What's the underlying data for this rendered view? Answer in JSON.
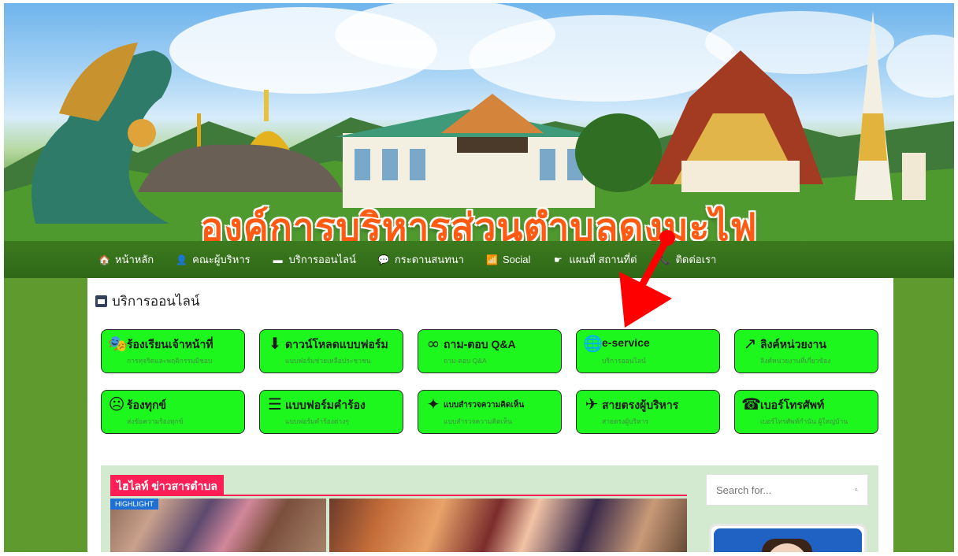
{
  "banner": {
    "title": "องค์การบริหารส่วนตำบลดงมะไฟ"
  },
  "nav": {
    "items": [
      {
        "label": "หน้าหลัก",
        "icon": "home-icon",
        "glyph": "🏠"
      },
      {
        "label": "คณะผู้บริหาร",
        "icon": "user-icon",
        "glyph": "👤"
      },
      {
        "label": "บริการออนไลน์",
        "icon": "window-icon",
        "glyph": "▬"
      },
      {
        "label": "กระดานสนทนา",
        "icon": "comments-icon",
        "glyph": "💬"
      },
      {
        "label": "Social",
        "icon": "rss-icon",
        "glyph": "📶"
      },
      {
        "label": "แผนที่ สถานที่ต่",
        "icon": "map-icon",
        "glyph": "☛"
      },
      {
        "label": "ติดต่อเรา",
        "icon": "phone-icon",
        "glyph": "📞"
      }
    ]
  },
  "services": {
    "heading": "บริการออนไลน์",
    "tiles": [
      {
        "title": "ร้องเรียนเจ้าหน้าที่",
        "sub": "การทุจริตและพฤติกรรมมิชอบ",
        "icon": "masks-icon",
        "glyph": "🎭"
      },
      {
        "title": "ดาวน์โหลดแบบฟอร์ม",
        "sub": "แบบฟอร์มช่วยเหลือประชาชน",
        "icon": "download-circle-icon",
        "glyph": "⬇"
      },
      {
        "title": "ถาม-ตอบ Q&A",
        "sub": "ถาม-ตอบ Q&A",
        "icon": "infinity-icon",
        "glyph": "∞"
      },
      {
        "title": "e-service",
        "sub": "บริการออนไลน์",
        "icon": "globe-icon",
        "glyph": "🌐"
      },
      {
        "title": "ลิงค์หน่วยงาน",
        "sub": "ลิงค์หน่วยงานที่เกี่ยวข้อง",
        "icon": "external-link-icon",
        "glyph": "↗"
      },
      {
        "title": "ร้องทุกข์",
        "sub": "ส่งข้อความร้องทุกข์",
        "icon": "sad-face-icon",
        "glyph": "☹"
      },
      {
        "title": "แบบฟอร์มคำร้อง",
        "sub": "แบบฟอร์มคำร้องต่างๆ",
        "icon": "list-icon",
        "glyph": "☰"
      },
      {
        "title": "แบบสำรวจความคิดเห็น",
        "sub": "แบบสำรวจความคิดเห็น",
        "icon": "magic-wand-icon",
        "glyph": "✦"
      },
      {
        "title": "สายตรงผู้บริหาร",
        "sub": "สายตรงผู้บริหาร",
        "icon": "paper-plane-icon",
        "glyph": "✈"
      },
      {
        "title": "เบอร์โทรศัพท์",
        "sub": "เบอร์โทรศัพท์กำนัน ผู้ใหญ่บ้าน",
        "icon": "phone-square-icon",
        "glyph": "☎"
      }
    ]
  },
  "news": {
    "tab_label": "ไฮไลท์ ข่าวสารตำบล",
    "badge": "HIGHLIGHT"
  },
  "search": {
    "placeholder": "Search for...",
    "icon": "search-icon"
  },
  "colors": {
    "tile_bg": "#1ef71e",
    "nav_bg": "#2f6817",
    "title_orange": "#ff5a12",
    "highlight_red": "#ff1e55",
    "arrow_red": "#ff0000"
  }
}
